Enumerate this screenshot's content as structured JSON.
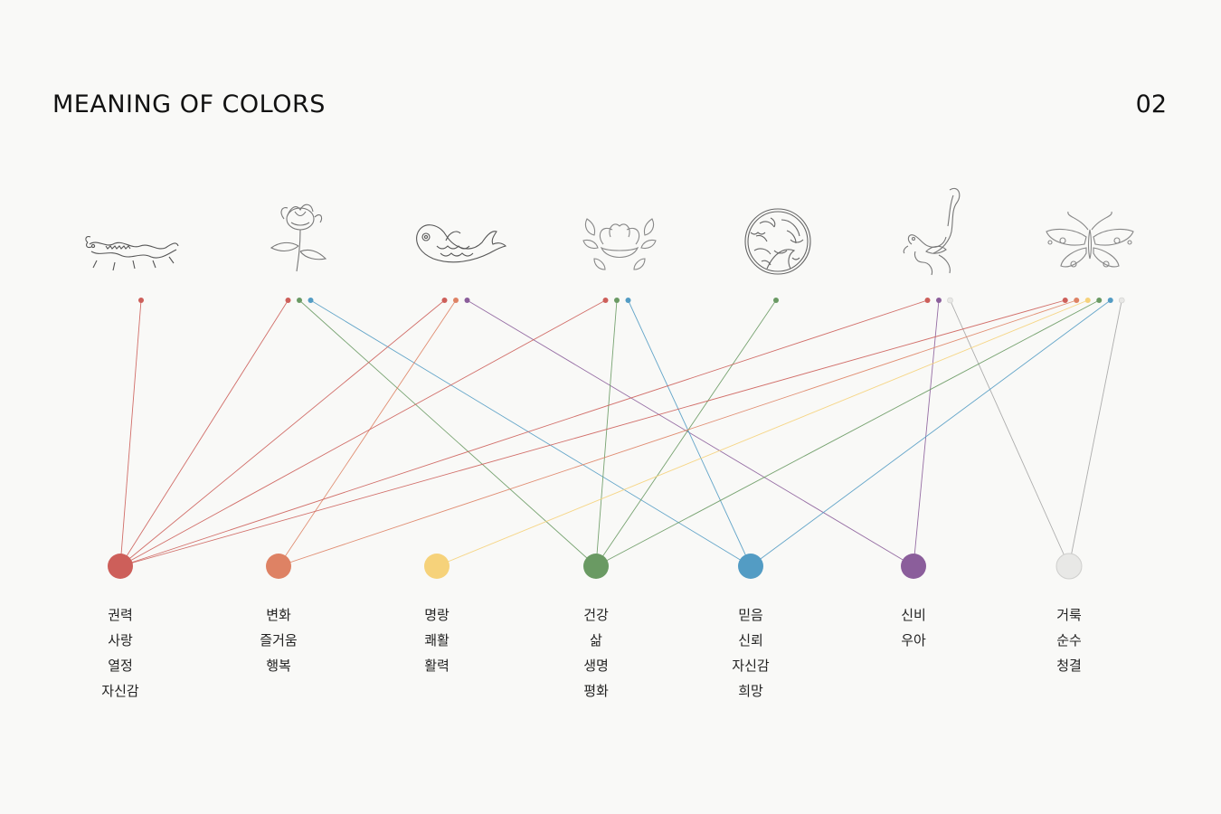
{
  "header": {
    "title": "MEANING OF COLORS",
    "page_number": "02"
  },
  "colors": {
    "red": "#cd5f5a",
    "orange": "#de8264",
    "yellow": "#f6d27a",
    "green": "#6a9a63",
    "blue": "#539cc4",
    "purple": "#8b5e9b",
    "white": "#e8e8e6"
  },
  "motifs": [
    {
      "icon": "dragon-icon",
      "dots": [
        "red"
      ]
    },
    {
      "icon": "chrysanthemum-icon",
      "dots": [
        "red",
        "green",
        "blue"
      ]
    },
    {
      "icon": "fish-icon",
      "dots": [
        "red",
        "orange",
        "purple"
      ]
    },
    {
      "icon": "peony-icon",
      "dots": [
        "red",
        "green",
        "blue"
      ]
    },
    {
      "icon": "crane-medallion-icon",
      "dots": [
        "green"
      ]
    },
    {
      "icon": "phoenix-icon",
      "dots": [
        "red",
        "purple",
        "white"
      ]
    },
    {
      "icon": "butterfly-icon",
      "dots": [
        "red",
        "orange",
        "yellow",
        "green",
        "blue",
        "white"
      ]
    }
  ],
  "color_groups": [
    {
      "color": "red",
      "meanings": [
        "권력",
        "사랑",
        "열정",
        "자신감"
      ]
    },
    {
      "color": "orange",
      "meanings": [
        "변화",
        "즐거움",
        "행복"
      ]
    },
    {
      "color": "yellow",
      "meanings": [
        "명랑",
        "쾌활",
        "활력"
      ]
    },
    {
      "color": "green",
      "meanings": [
        "건강",
        "삶",
        "생명",
        "평화"
      ]
    },
    {
      "color": "blue",
      "meanings": [
        "믿음",
        "신뢰",
        "자신감",
        "희망"
      ]
    },
    {
      "color": "purple",
      "meanings": [
        "신비",
        "우아"
      ]
    },
    {
      "color": "white",
      "meanings": [
        "거룩",
        "순수",
        "청결"
      ]
    }
  ]
}
